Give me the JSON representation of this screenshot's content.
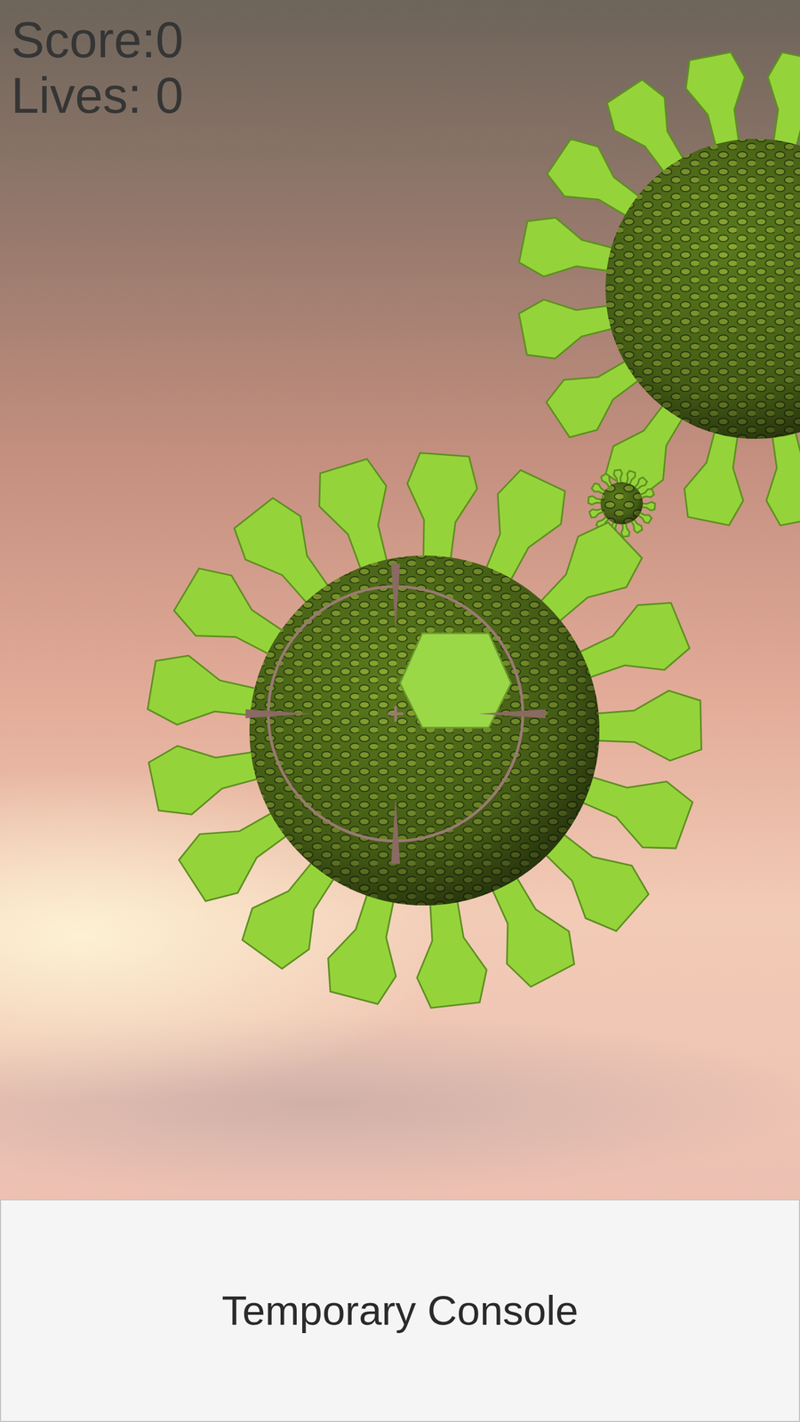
{
  "hud": {
    "score": "Score:0",
    "lives": "Lives: 0"
  },
  "console_button": {
    "label": "Temporary Console"
  }
}
